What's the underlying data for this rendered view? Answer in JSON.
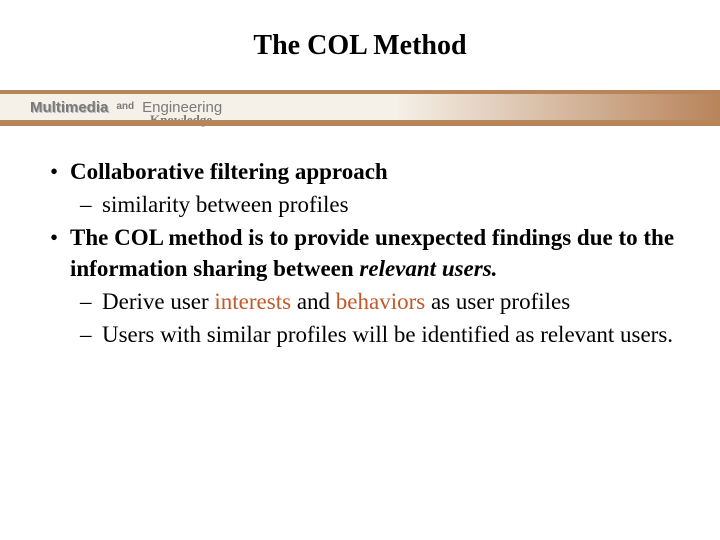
{
  "title": "The COL Method",
  "banner": {
    "multimedia": "Multimedia",
    "and": "and",
    "engineering": "Engineering",
    "knowledge": "Knowledge"
  },
  "bullet1": {
    "marker": "•",
    "text": "Collaborative filtering approach"
  },
  "sub1": {
    "marker": "–",
    "text": "similarity between profiles"
  },
  "bullet2": {
    "marker": "•",
    "part1": "The COL method is to provide unexpected findings due to the information sharing between ",
    "part2": "relevant users."
  },
  "sub2": {
    "marker": "–",
    "part1": "Derive user ",
    "part2": "interests",
    "part3": " and ",
    "part4": "behaviors",
    "part5": " as user profiles"
  },
  "sub3": {
    "marker": "–",
    "text": "Users with similar profiles will be identified as relevant users."
  }
}
